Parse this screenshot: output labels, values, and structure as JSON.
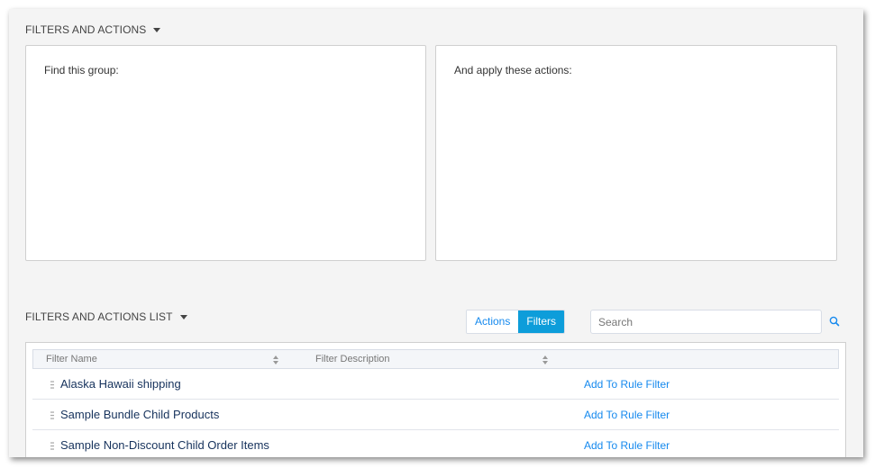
{
  "filters_and_actions": {
    "title": "FILTERS AND ACTIONS",
    "find_group_label": "Find this group:",
    "apply_actions_label": "And apply these actions:"
  },
  "list_section": {
    "title": "FILTERS AND ACTIONS LIST",
    "toggle": {
      "actions_label": "Actions",
      "filters_label": "Filters",
      "active": "Filters"
    },
    "search": {
      "placeholder": "Search",
      "value": ""
    }
  },
  "table": {
    "columns": [
      "Filter Name",
      "Filter Description"
    ],
    "rows": [
      {
        "name": "Alaska Hawaii shipping",
        "action": "Add To Rule Filter"
      },
      {
        "name": "Sample Bundle Child Products",
        "action": "Add To Rule Filter"
      },
      {
        "name": "Sample Non-Discount Child Order Items",
        "action": "Add To Rule Filter"
      }
    ]
  },
  "colors": {
    "accent": "#0d9dda",
    "link": "#1589ee",
    "background": "#f4f4f4"
  }
}
